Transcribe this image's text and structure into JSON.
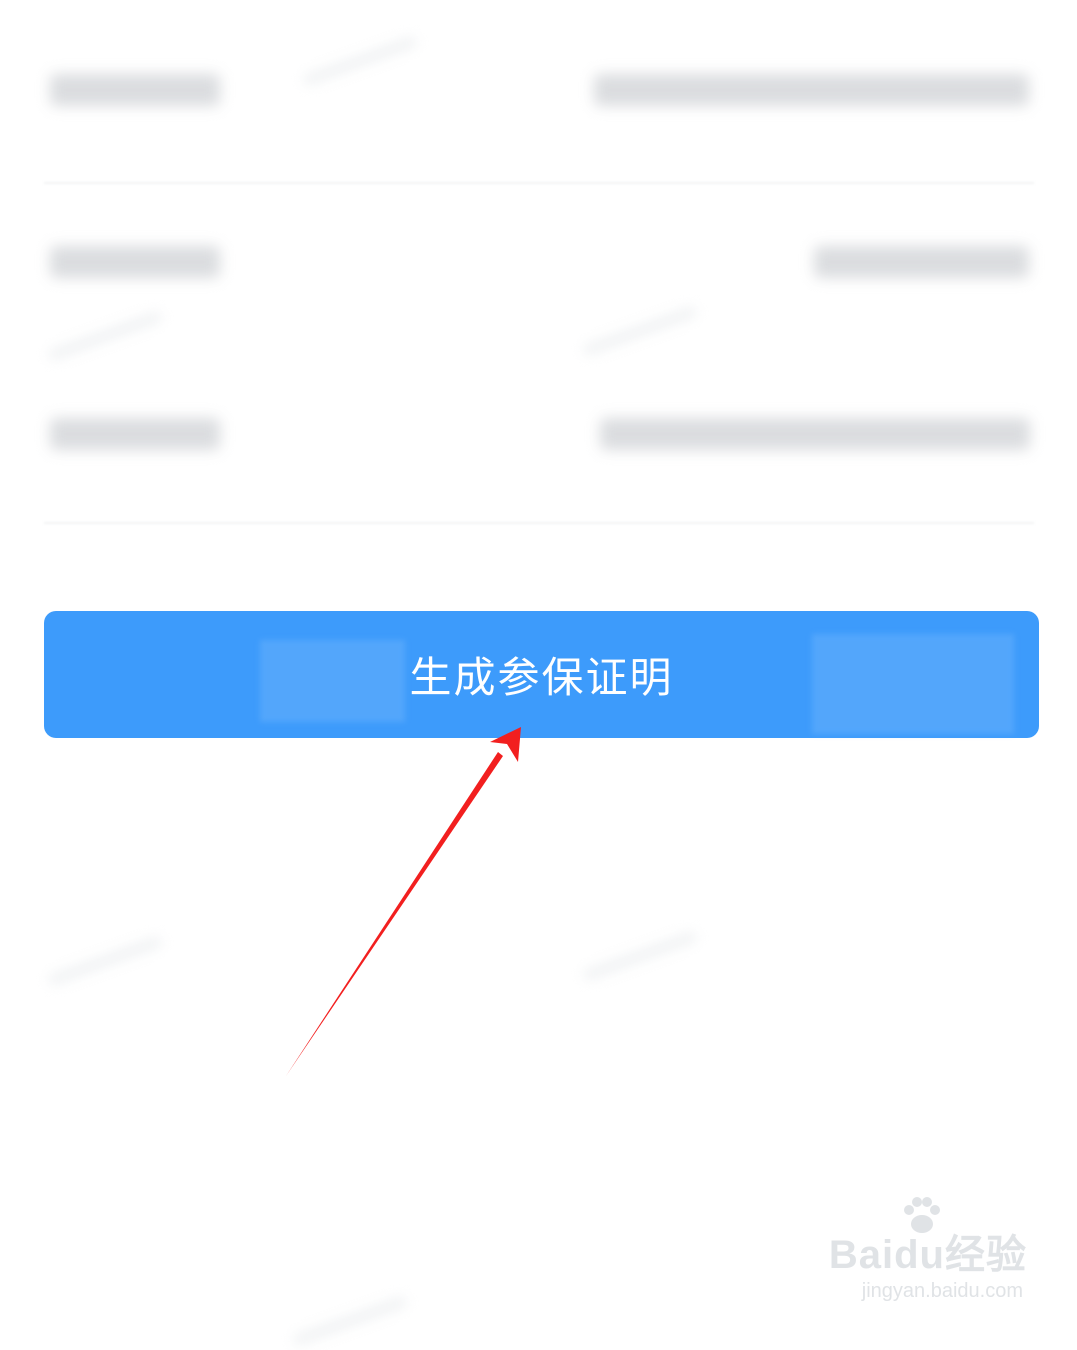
{
  "action_button": {
    "label": "生成参保证明"
  },
  "watermark": {
    "brand": "Baidu经验",
    "url": "jingyan.baidu.com",
    "icon": "paw-icon"
  },
  "colors": {
    "button_bg": "#3d9bfb",
    "button_text": "#ffffff",
    "arrow": "#f21f1f",
    "background": "#ffffff"
  }
}
